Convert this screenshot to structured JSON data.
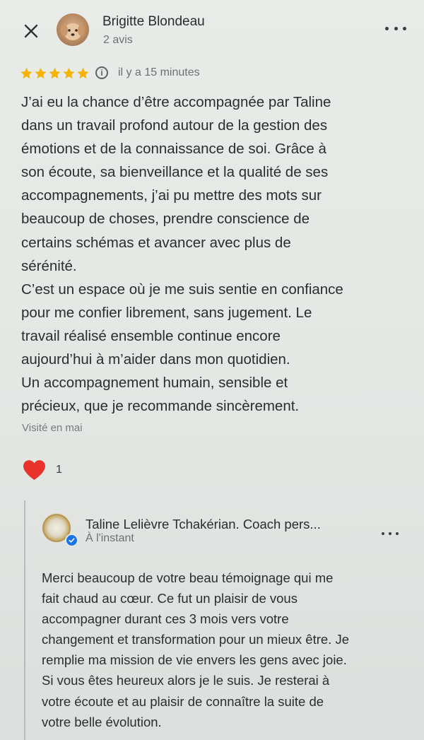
{
  "review": {
    "reviewer_name": "Brigitte Blondeau",
    "reviewer_count": "2 avis",
    "rating": 5,
    "time_ago": "il y a 15 minutes",
    "text_lines": [
      "J’ai eu la chance d’être accompagnée par Taline",
      "dans un travail profond autour de la gestion des",
      "émotions et de la connaissance de soi. Grâce à",
      "son écoute, sa bienveillance et la qualité de ses",
      "accompagnements, j’ai pu mettre des mots sur",
      "beaucoup de choses, prendre conscience de",
      "certains schémas et avancer avec plus de",
      "sérénité.",
      "C’est un espace où je me suis sentie en confiance",
      "pour me confier librement, sans jugement. Le",
      "travail réalisé ensemble continue encore",
      "aujourd’hui à m’aider dans mon quotidien.",
      "Un accompagnement humain, sensible et",
      "précieux, que je recommande sincèrement."
    ],
    "visited": "Visité en mai",
    "reaction_count": "1"
  },
  "reply": {
    "owner_name": "Taline Lelièvre Tchakérian. Coach pers...",
    "time": "À l'instant",
    "text_lines": [
      "Merci beaucoup de votre beau témoignage qui me",
      "fait chaud au cœur. Ce fut un plaisir de vous",
      "accompagner durant ces 3 mois vers votre",
      "changement et transformation pour un mieux être. Je",
      "remplie ma mission de vie envers les gens avec joie.",
      "Si vous êtes heureux alors je le suis. Je resterai à",
      "votre écoute et au plaisir de connaître la suite de",
      "votre belle évolution."
    ]
  },
  "colors": {
    "star": "#f4b400",
    "heart": "#e8322b",
    "verified": "#1a73e8"
  },
  "icons": [
    "close-icon",
    "more-vert-icon",
    "star-icon",
    "info-icon",
    "heart-icon",
    "verified-icon"
  ]
}
